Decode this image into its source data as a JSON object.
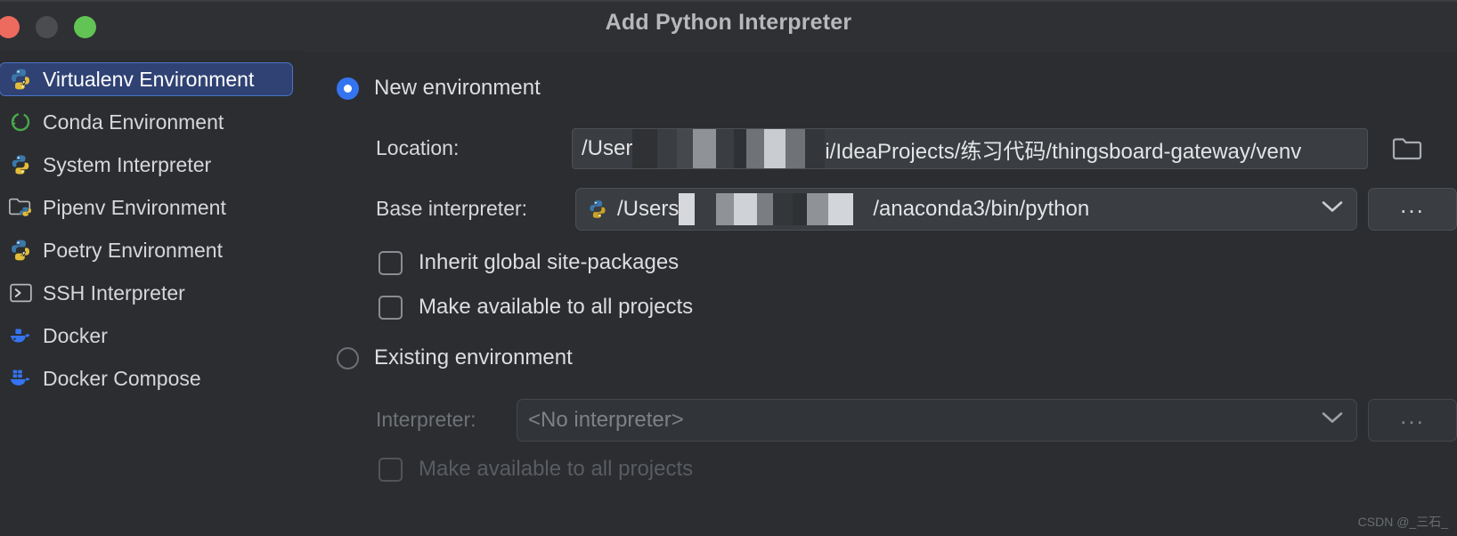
{
  "window": {
    "title": "Add Python Interpreter",
    "traffic_lights": [
      "close",
      "minimize",
      "maximize"
    ]
  },
  "sidebar": {
    "items": [
      {
        "label": "Virtualenv Environment",
        "icon": "python-virtualenv-icon",
        "selected": true
      },
      {
        "label": "Conda Environment",
        "icon": "conda-icon",
        "selected": false
      },
      {
        "label": "System Interpreter",
        "icon": "python-icon",
        "selected": false
      },
      {
        "label": "Pipenv Environment",
        "icon": "pipenv-folder-icon",
        "selected": false
      },
      {
        "label": "Poetry Environment",
        "icon": "poetry-icon",
        "selected": false
      },
      {
        "label": "SSH Interpreter",
        "icon": "terminal-icon",
        "selected": false
      },
      {
        "label": "Docker",
        "icon": "docker-icon",
        "selected": false
      },
      {
        "label": "Docker Compose",
        "icon": "docker-compose-icon",
        "selected": false
      }
    ]
  },
  "main": {
    "new_environment": {
      "radio_label": "New environment",
      "selected": true,
      "location": {
        "label": "Location:",
        "value_prefix": "/User",
        "value_suffix": "i/IdeaProjects/练习代码/thingsboard-gateway/venv",
        "browse_icon": "folder-icon"
      },
      "base_interpreter": {
        "label": "Base interpreter:",
        "icon": "python-icon",
        "value_prefix": "/Users",
        "value_suffix": "/anaconda3/bin/python",
        "dropdown_icon": "chevron-down-icon",
        "more_label": "..."
      },
      "checkboxes": [
        {
          "label": "Inherit global site-packages",
          "checked": false,
          "disabled": false
        },
        {
          "label": "Make available to all projects",
          "checked": false,
          "disabled": false
        }
      ]
    },
    "existing_environment": {
      "radio_label": "Existing environment",
      "selected": false,
      "interpreter": {
        "label": "Interpreter:",
        "value": "<No interpreter>",
        "dropdown_icon": "chevron-down-icon",
        "more_label": "..."
      },
      "checkboxes": [
        {
          "label": "Make available to all projects",
          "checked": false,
          "disabled": true
        }
      ]
    }
  },
  "watermark": "CSDN @_三石_",
  "colors": {
    "background": "#2b2d30",
    "titlebar": "#2e3033",
    "accent": "#3574f0",
    "selection": "#2f4273",
    "selection_border": "#4a74c7",
    "field": "#3a3d41",
    "text": "#dcdddf",
    "text_disabled": "#6f7276"
  }
}
